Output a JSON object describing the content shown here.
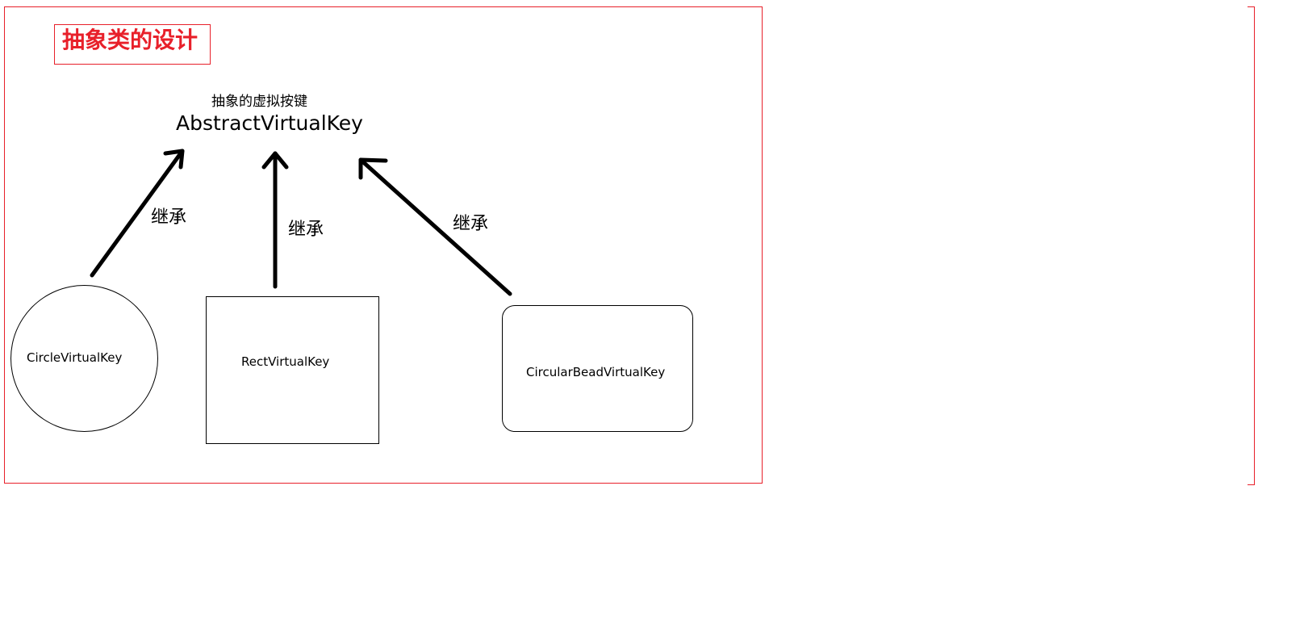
{
  "diagram": {
    "title": "抽象类的设计",
    "parent": {
      "caption_cn": "抽象的虚拟按键",
      "name": "AbstractVirtualKey"
    },
    "relation_label": "继承",
    "children": [
      {
        "name": "CircleVirtualKey",
        "shape": "circle"
      },
      {
        "name": "RectVirtualKey",
        "shape": "rectangle"
      },
      {
        "name": "CircularBeadVirtualKey",
        "shape": "rounded-rectangle"
      }
    ],
    "colors": {
      "frame": "#e8202a",
      "title": "#e8202a",
      "ink": "#000000"
    }
  }
}
